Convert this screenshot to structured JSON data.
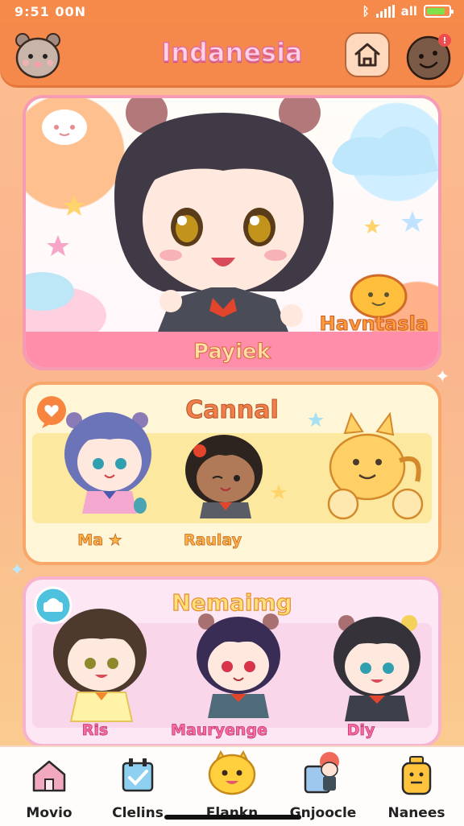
{
  "status_bar": {
    "time": "9:51 00N",
    "network": "all"
  },
  "header": {
    "title": "Indanesia",
    "avatar_left": "bear-avatar-icon",
    "home_button": "home-icon",
    "avatar_right": "profile-avatar-icon"
  },
  "hero": {
    "caption": "Payiek",
    "badge": "Havntasla"
  },
  "sections": [
    {
      "title": "Cannal",
      "characters": [
        "Ma ★",
        "Raulay"
      ]
    },
    {
      "title": "Nemaimg",
      "characters": [
        "Ris",
        "Mauryenge",
        "Diy"
      ]
    }
  ],
  "nav": {
    "items": [
      {
        "label": "Movio",
        "icon": "home-icon"
      },
      {
        "label": "Clelins",
        "icon": "calendar-check-icon"
      },
      {
        "label": "Elankn",
        "icon": "mascot-icon"
      },
      {
        "label": "Gnjoocle",
        "icon": "character-card-icon"
      },
      {
        "label": "Nanees",
        "icon": "pot-icon"
      }
    ]
  },
  "colors": {
    "header": "#f5894b",
    "accent_pink": "#f59bb3",
    "accent_orange": "#f9a66b"
  }
}
